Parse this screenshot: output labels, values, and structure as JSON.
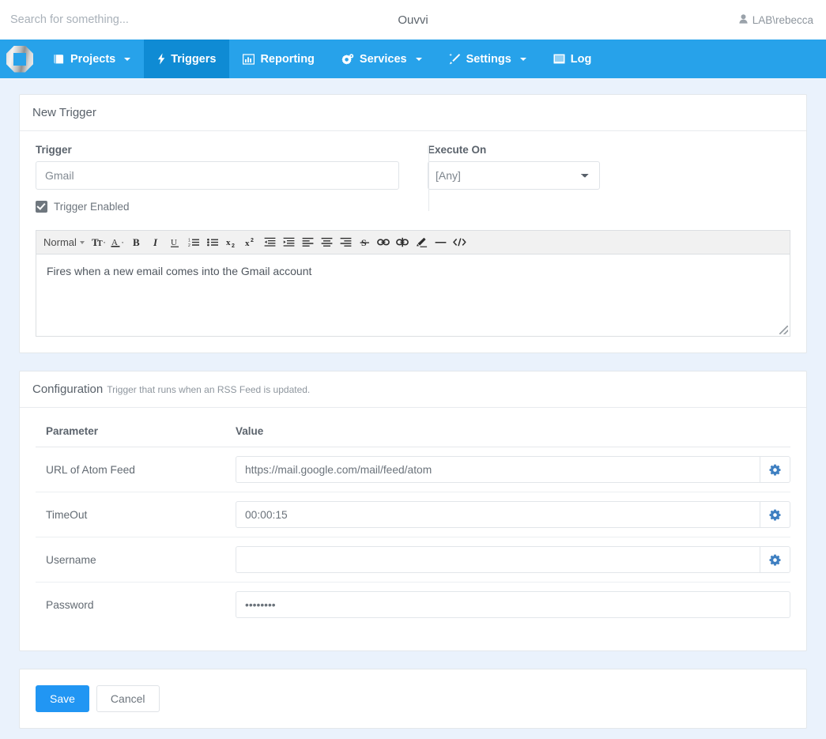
{
  "header": {
    "search_placeholder": "Search for something...",
    "search_value": "",
    "app_title": "Ouvvi",
    "user": "LAB\\rebecca",
    "user_icon": "user-icon"
  },
  "nav": {
    "logo_icon": "ouvvi-logo-icon",
    "items": [
      {
        "label": "Projects",
        "icon": "book-icon",
        "caret": true,
        "active": false
      },
      {
        "label": "Triggers",
        "icon": "bolt-icon",
        "caret": false,
        "active": true
      },
      {
        "label": "Reporting",
        "icon": "bar-chart-icon",
        "caret": false,
        "active": false
      },
      {
        "label": "Services",
        "icon": "cogs-icon",
        "caret": true,
        "active": false
      },
      {
        "label": "Settings",
        "icon": "magic-wand-icon",
        "caret": true,
        "active": false
      },
      {
        "label": "Log",
        "icon": "list-icon",
        "caret": false,
        "active": false
      }
    ]
  },
  "trigger_card": {
    "title": "New Trigger",
    "trigger_label": "Trigger",
    "trigger_value": "Gmail",
    "trigger_placeholder": "Trigger",
    "enabled_label": "Trigger Enabled",
    "enabled_checked": true,
    "execute_on_label": "Execute On",
    "execute_on_selected": "[Any]",
    "execute_on_options": [
      "[Any]"
    ]
  },
  "editor": {
    "format_label": "Normal",
    "content": "Fires when a new email comes into the Gmail account",
    "tools": [
      "font-size-icon",
      "font-color-icon",
      "bold-icon",
      "italic-icon",
      "underline-icon",
      "ordered-list-icon",
      "unordered-list-icon",
      "subscript-icon",
      "superscript-icon",
      "outdent-icon",
      "indent-icon",
      "align-left-icon",
      "align-center-icon",
      "align-right-icon",
      "strikethrough-icon",
      "link-icon",
      "unlink-icon",
      "highlight-icon",
      "horizontal-rule-icon",
      "source-code-icon"
    ]
  },
  "configuration": {
    "title": "Configuration",
    "subtitle": "Trigger that runs when an RSS Feed is updated.",
    "columns": [
      "Parameter",
      "Value"
    ],
    "rows": [
      {
        "parameter": "URL of Atom Feed",
        "value": "https://mail.google.com/mail/feed/atom",
        "gear": true,
        "password": false
      },
      {
        "parameter": "TimeOut",
        "value": "00:00:15",
        "gear": true,
        "password": false
      },
      {
        "parameter": "Username",
        "value": "",
        "gear": true,
        "password": false
      },
      {
        "parameter": "Password",
        "value": "••••••••",
        "gear": false,
        "password": true
      }
    ],
    "gear_icon": "gear-icon"
  },
  "footer": {
    "save_label": "Save",
    "cancel_label": "Cancel"
  },
  "colors": {
    "nav_blue": "#27a2ea",
    "nav_active_blue": "#0f8bd4",
    "primary_button": "#2196f3",
    "page_background": "#eaf2fc",
    "gear_blue": "#3e7fc1"
  }
}
